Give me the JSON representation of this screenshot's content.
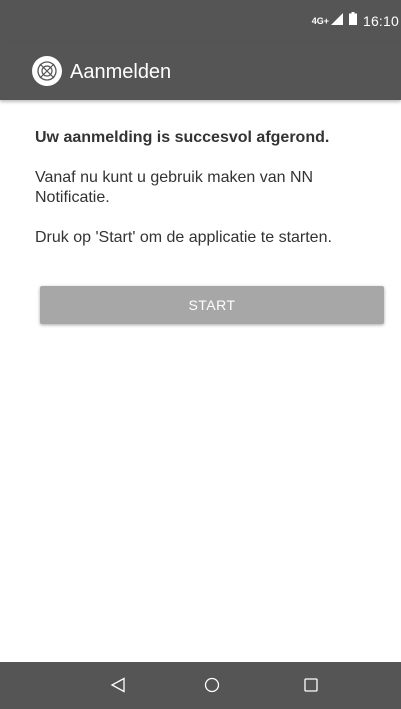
{
  "status_bar": {
    "network": "4G+",
    "time": "16:10",
    "icons": [
      "signal-icon",
      "battery-icon"
    ]
  },
  "app_bar": {
    "title": "Aanmelden",
    "logo_icon": "nn-logo-icon"
  },
  "content": {
    "heading": "Uw aanmelding is succesvol afgerond.",
    "paragraph_1": "Vanaf nu kunt u gebruik maken van NN Notificatie.",
    "paragraph_2": "Druk op 'Start' om de applicatie te starten."
  },
  "start_button": {
    "label": "START"
  },
  "nav_bar": {
    "icons": [
      "back-icon",
      "home-icon",
      "recents-icon"
    ]
  },
  "colors": {
    "bar_background": "#555555",
    "button_background": "#a7a7a7",
    "text": "#333333"
  }
}
